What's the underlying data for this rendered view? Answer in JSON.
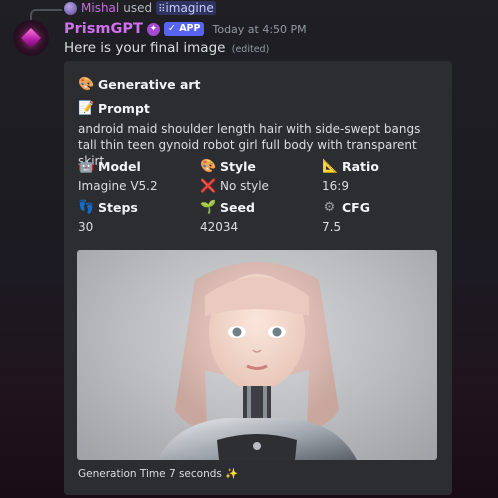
{
  "reply": {
    "user": "Mishal",
    "used_text": "used",
    "command": "imagine"
  },
  "header": {
    "bot_name": "PrismGPT",
    "app_tag": "APP",
    "timestamp": "Today at 4:50 PM"
  },
  "message": {
    "text": "Here is your final image",
    "edited": "(edited)"
  },
  "embed": {
    "title": "Generative art",
    "prompt_label": "Prompt",
    "prompt": "android maid shoulder length hair with side-swept bangs tall thin teen gynoid robot girl full body with transparent skirt",
    "fields": {
      "model_label": "Model",
      "model_value": "Imagine V5.2",
      "style_label": "Style",
      "style_value": "No style",
      "ratio_label": "Ratio",
      "ratio_value": "16:9",
      "steps_label": "Steps",
      "steps_value": "30",
      "seed_label": "Seed",
      "seed_value": "42034",
      "cfg_label": "CFG",
      "cfg_value": "7.5"
    },
    "footer": "Generation Time 7 seconds"
  },
  "icons": {
    "title": "palette-icon",
    "prompt": "memo-icon",
    "model": "robot-icon",
    "style": "palette-icon",
    "style_value": "cross-mark-icon",
    "ratio": "triangle-ruler-icon",
    "steps": "footprints-icon",
    "seed": "seedling-icon",
    "cfg": "gear-icon",
    "footer": "sparkles-icon"
  },
  "colors": {
    "bot_name": "#d070f0",
    "app_tag": "#5865f2",
    "embed_bg": "#2b2d31",
    "reply_user": "#c46ee0"
  }
}
